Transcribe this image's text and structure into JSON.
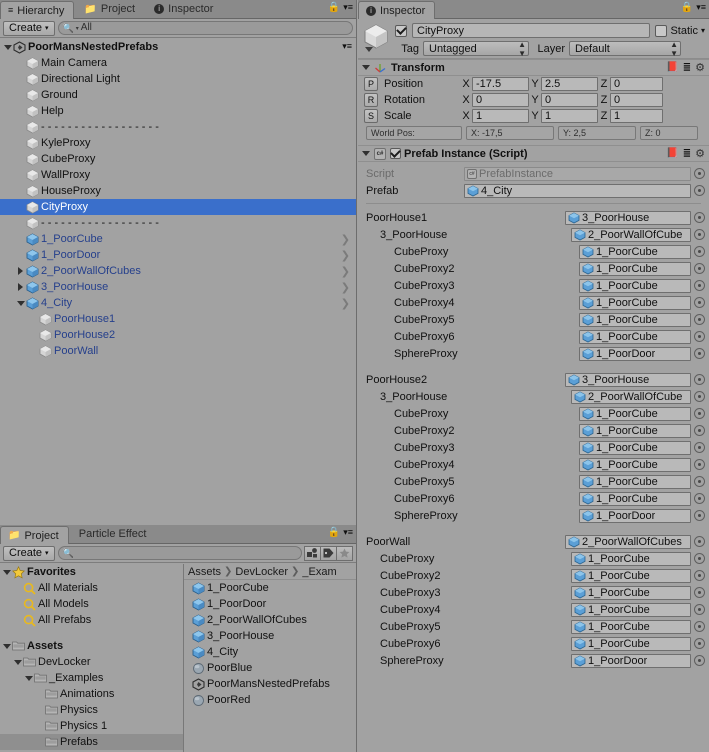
{
  "hierarchy": {
    "tabs": [
      {
        "label": "Hierarchy",
        "icon": "hierarchy-icon",
        "active": true
      },
      {
        "label": "Project",
        "icon": "folder-icon",
        "active": false
      },
      {
        "label": "Inspector",
        "icon": "info-icon",
        "active": false
      }
    ],
    "toolbar": {
      "create_label": "Create",
      "search_value": "All",
      "search_placeholder": "All"
    },
    "scene": {
      "name": "PoorMansNestedPrefabs"
    },
    "rows": [
      {
        "label": "Main Camera",
        "indent": 1,
        "type": "object",
        "fold": "",
        "chevron": false,
        "selected": false
      },
      {
        "label": "Directional Light",
        "indent": 1,
        "type": "object",
        "fold": "",
        "chevron": false,
        "selected": false
      },
      {
        "label": "Ground",
        "indent": 1,
        "type": "object",
        "fold": "",
        "chevron": false,
        "selected": false
      },
      {
        "label": "Help",
        "indent": 1,
        "type": "object",
        "fold": "",
        "chevron": false,
        "selected": false
      },
      {
        "label": "- - - - - - - - - - - - - - - - - -",
        "indent": 1,
        "type": "object",
        "fold": "",
        "chevron": false,
        "selected": false
      },
      {
        "label": "KyleProxy",
        "indent": 1,
        "type": "object",
        "fold": "",
        "chevron": false,
        "selected": false
      },
      {
        "label": "CubeProxy",
        "indent": 1,
        "type": "object",
        "fold": "",
        "chevron": false,
        "selected": false
      },
      {
        "label": "WallProxy",
        "indent": 1,
        "type": "object",
        "fold": "",
        "chevron": false,
        "selected": false
      },
      {
        "label": "HouseProxy",
        "indent": 1,
        "type": "object",
        "fold": "",
        "chevron": false,
        "selected": false
      },
      {
        "label": "CityProxy",
        "indent": 1,
        "type": "object",
        "fold": "",
        "chevron": false,
        "selected": true
      },
      {
        "label": "- - - - - - - - - - - - - - - - - -",
        "indent": 1,
        "type": "object",
        "fold": "",
        "chevron": false,
        "selected": false
      },
      {
        "label": "1_PoorCube",
        "indent": 1,
        "type": "prefab",
        "fold": "",
        "chevron": true,
        "selected": false
      },
      {
        "label": "1_PoorDoor",
        "indent": 1,
        "type": "prefab",
        "fold": "",
        "chevron": true,
        "selected": false
      },
      {
        "label": "2_PoorWallOfCubes",
        "indent": 1,
        "type": "prefab",
        "fold": "right",
        "chevron": true,
        "selected": false
      },
      {
        "label": "3_PoorHouse",
        "indent": 1,
        "type": "prefab",
        "fold": "right",
        "chevron": true,
        "selected": false
      },
      {
        "label": "4_City",
        "indent": 1,
        "type": "prefab",
        "fold": "down",
        "chevron": true,
        "selected": false
      },
      {
        "label": "PoorHouse1",
        "indent": 2,
        "type": "prefab-child",
        "fold": "",
        "chevron": false,
        "selected": false
      },
      {
        "label": "PoorHouse2",
        "indent": 2,
        "type": "prefab-child",
        "fold": "",
        "chevron": false,
        "selected": false
      },
      {
        "label": "PoorWall",
        "indent": 2,
        "type": "prefab-child",
        "fold": "",
        "chevron": false,
        "selected": false
      }
    ]
  },
  "project": {
    "tabs": [
      {
        "label": "Project",
        "icon": "folder-icon",
        "active": true
      },
      {
        "label": "Particle Effect",
        "icon": "",
        "active": false
      }
    ],
    "toolbar": {
      "create_label": "Create",
      "search_value": "",
      "search_placeholder": ""
    },
    "tree": [
      {
        "label": "Favorites",
        "indent": 0,
        "fold": "down",
        "icon": "star-icon",
        "bold": true,
        "selected": false
      },
      {
        "label": "All Materials",
        "indent": 1,
        "fold": "",
        "icon": "search-icon",
        "bold": false,
        "selected": false
      },
      {
        "label": "All Models",
        "indent": 1,
        "fold": "",
        "icon": "search-icon",
        "bold": false,
        "selected": false
      },
      {
        "label": "All Prefabs",
        "indent": 1,
        "fold": "",
        "icon": "search-icon",
        "bold": false,
        "selected": false
      },
      {
        "label": "",
        "indent": 0,
        "fold": "",
        "icon": "",
        "bold": false,
        "selected": false
      },
      {
        "label": "Assets",
        "indent": 0,
        "fold": "down",
        "icon": "folder-icon",
        "bold": true,
        "selected": false
      },
      {
        "label": "DevLocker",
        "indent": 1,
        "fold": "down",
        "icon": "folder-icon",
        "bold": false,
        "selected": false
      },
      {
        "label": "_Examples",
        "indent": 2,
        "fold": "down",
        "icon": "folder-icon",
        "bold": false,
        "selected": false
      },
      {
        "label": "Animations",
        "indent": 3,
        "fold": "",
        "icon": "folder-icon",
        "bold": false,
        "selected": false
      },
      {
        "label": "Physics",
        "indent": 3,
        "fold": "",
        "icon": "folder-icon",
        "bold": false,
        "selected": false
      },
      {
        "label": "Physics 1",
        "indent": 3,
        "fold": "",
        "icon": "folder-icon",
        "bold": false,
        "selected": false
      },
      {
        "label": "Prefabs",
        "indent": 3,
        "fold": "",
        "icon": "folder-icon",
        "bold": false,
        "selected": true
      }
    ],
    "breadcrumb": [
      "Assets",
      "DevLocker",
      "_Exam"
    ],
    "files": [
      {
        "label": "1_PoorCube",
        "icon": "prefab-icon"
      },
      {
        "label": "1_PoorDoor",
        "icon": "prefab-icon"
      },
      {
        "label": "2_PoorWallOfCubes",
        "icon": "prefab-icon"
      },
      {
        "label": "3_PoorHouse",
        "icon": "prefab-icon"
      },
      {
        "label": "4_City",
        "icon": "prefab-icon"
      },
      {
        "label": "PoorBlue",
        "icon": "material-icon"
      },
      {
        "label": "PoorMansNestedPrefabs",
        "icon": "scene-icon"
      },
      {
        "label": "PoorRed",
        "icon": "material-icon"
      }
    ]
  },
  "inspector": {
    "tab": {
      "label": "Inspector",
      "icon": "info-icon"
    },
    "object": {
      "name": "CityProxy",
      "enabled": true,
      "static_label": "Static",
      "static_checked": false,
      "tag_label": "Tag",
      "tag_value": "Untagged",
      "layer_label": "Layer",
      "layer_value": "Default"
    },
    "transform": {
      "title": "Transform",
      "rows": [
        {
          "key": "P",
          "label": "Position",
          "x": "-17.5",
          "y": "2.5",
          "z": "0"
        },
        {
          "key": "R",
          "label": "Rotation",
          "x": "0",
          "y": "0",
          "z": "0"
        },
        {
          "key": "S",
          "label": "Scale",
          "x": "1",
          "y": "1",
          "z": "1"
        }
      ],
      "world_pos_label": "World Pos:",
      "world_x": "X: -17,5",
      "world_y": "Y: 2,5",
      "world_z": "Z: 0"
    },
    "prefab_instance": {
      "title": "Prefab Instance (Script)",
      "enabled": true,
      "script_label": "Script",
      "script_value": "PrefabInstance",
      "prefab_label": "Prefab",
      "prefab_value": "4_City",
      "groups": [
        {
          "rows": [
            {
              "label": "PoorHouse1",
              "value": "3_PoorHouse",
              "indent": 0
            },
            {
              "label": "3_PoorHouse",
              "value": "2_PoorWallOfCube",
              "indent": 1
            },
            {
              "label": "CubeProxy",
              "value": "1_PoorCube",
              "indent": 2
            },
            {
              "label": "CubeProxy2",
              "value": "1_PoorCube",
              "indent": 2
            },
            {
              "label": "CubeProxy3",
              "value": "1_PoorCube",
              "indent": 2
            },
            {
              "label": "CubeProxy4",
              "value": "1_PoorCube",
              "indent": 2
            },
            {
              "label": "CubeProxy5",
              "value": "1_PoorCube",
              "indent": 2
            },
            {
              "label": "CubeProxy6",
              "value": "1_PoorCube",
              "indent": 2
            },
            {
              "label": "SphereProxy",
              "value": "1_PoorDoor",
              "indent": 2
            }
          ]
        },
        {
          "rows": [
            {
              "label": "PoorHouse2",
              "value": "3_PoorHouse",
              "indent": 0
            },
            {
              "label": "3_PoorHouse",
              "value": "2_PoorWallOfCube",
              "indent": 1
            },
            {
              "label": "CubeProxy",
              "value": "1_PoorCube",
              "indent": 2
            },
            {
              "label": "CubeProxy2",
              "value": "1_PoorCube",
              "indent": 2
            },
            {
              "label": "CubeProxy3",
              "value": "1_PoorCube",
              "indent": 2
            },
            {
              "label": "CubeProxy4",
              "value": "1_PoorCube",
              "indent": 2
            },
            {
              "label": "CubeProxy5",
              "value": "1_PoorCube",
              "indent": 2
            },
            {
              "label": "CubeProxy6",
              "value": "1_PoorCube",
              "indent": 2
            },
            {
              "label": "SphereProxy",
              "value": "1_PoorDoor",
              "indent": 2
            }
          ]
        },
        {
          "rows": [
            {
              "label": "PoorWall",
              "value": "2_PoorWallOfCubes",
              "indent": 0
            },
            {
              "label": "CubeProxy",
              "value": "1_PoorCube",
              "indent": 1
            },
            {
              "label": "CubeProxy2",
              "value": "1_PoorCube",
              "indent": 1
            },
            {
              "label": "CubeProxy3",
              "value": "1_PoorCube",
              "indent": 1
            },
            {
              "label": "CubeProxy4",
              "value": "1_PoorCube",
              "indent": 1
            },
            {
              "label": "CubeProxy5",
              "value": "1_PoorCube",
              "indent": 1
            },
            {
              "label": "CubeProxy6",
              "value": "1_PoorCube",
              "indent": 1
            },
            {
              "label": "SphereProxy",
              "value": "1_PoorDoor",
              "indent": 1
            }
          ]
        }
      ]
    }
  },
  "colors": {
    "panel_bg": "#a2a2a2",
    "tabbar_bg": "#8a8a8a",
    "selection_blue": "#3a6fcb",
    "prefab_blue": "#26408c",
    "field_bg": "#b9b9b9"
  }
}
